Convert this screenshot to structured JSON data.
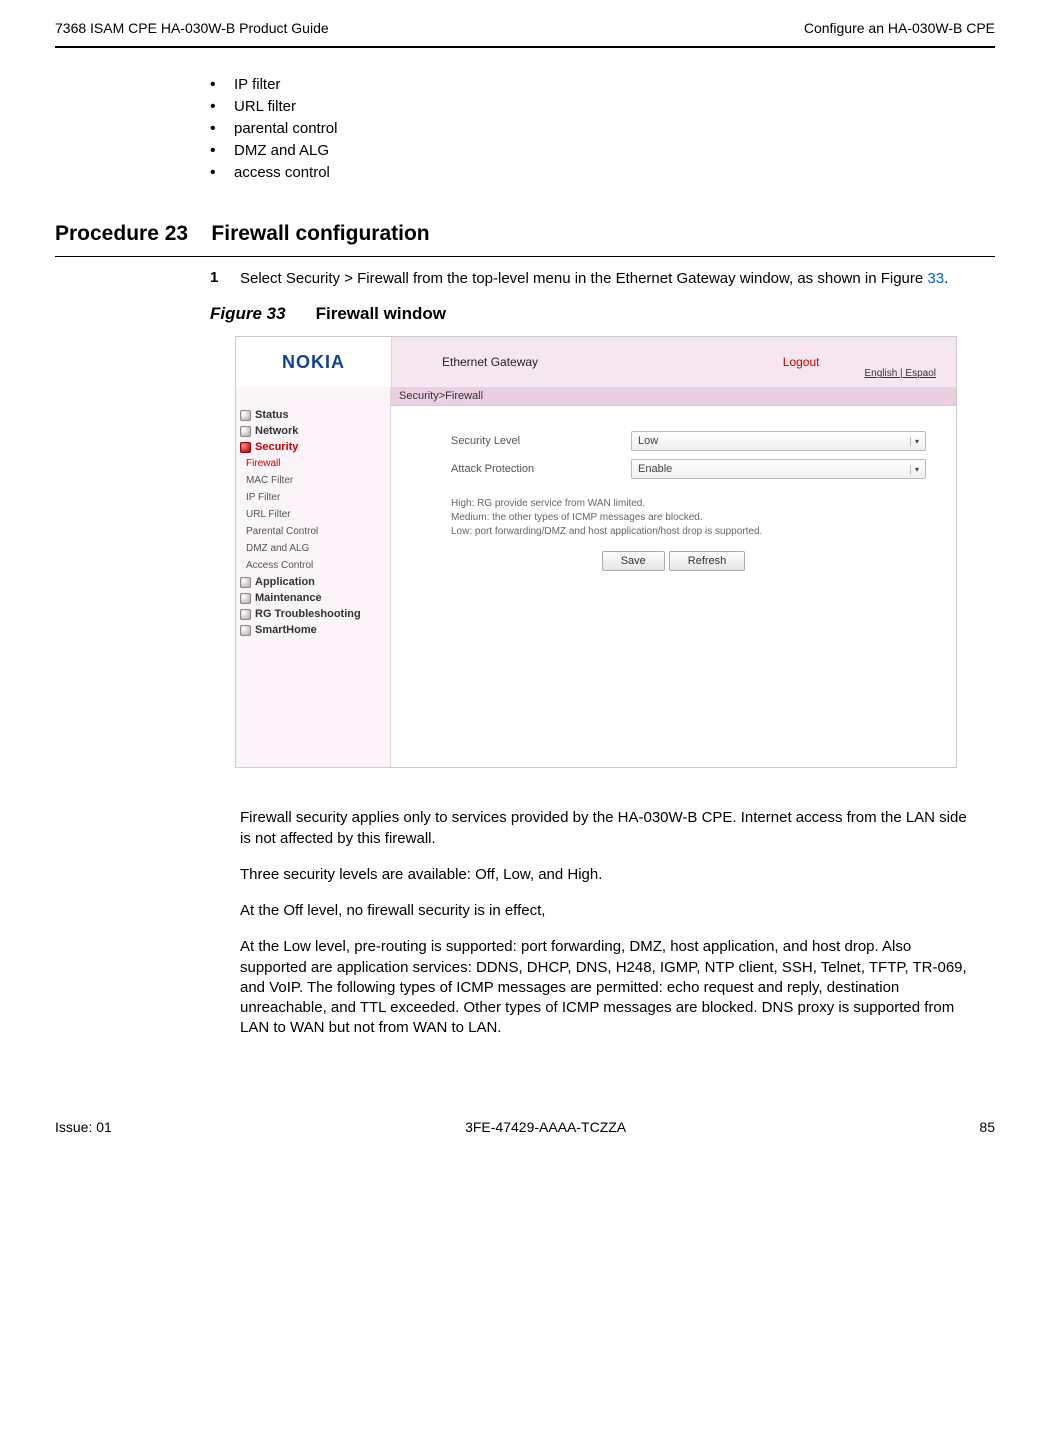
{
  "header": {
    "left": "7368 ISAM CPE HA-030W-B Product Guide",
    "right": "Configure an HA-030W-B CPE"
  },
  "bullets": [
    "IP filter",
    "URL filter",
    "parental control",
    "DMZ and ALG",
    "access control"
  ],
  "procedure": {
    "label": "Procedure 23",
    "title": "Firewall configuration"
  },
  "step1": {
    "num": "1",
    "text_before": "Select Security > Firewall from the top-level menu in the Ethernet Gateway window, as shown in Figure ",
    "link": "33",
    "text_after": "."
  },
  "figure": {
    "label": "Figure 33",
    "title": "Firewall window"
  },
  "screenshot": {
    "logo": "NOKIA",
    "title": "Ethernet Gateway",
    "logout": "Logout",
    "lang": "English | Espaol",
    "breadcrumb": "Security>Firewall",
    "sidebar": {
      "main": [
        "Status",
        "Network",
        "Security"
      ],
      "subs": [
        "Firewall",
        "MAC Filter",
        "IP Filter",
        "URL Filter",
        "Parental Control",
        "DMZ and ALG",
        "Access Control"
      ],
      "main2": [
        "Application",
        "Maintenance",
        "RG Troubleshooting",
        "SmartHome"
      ]
    },
    "form": {
      "row1": {
        "label": "Security Level",
        "value": "Low"
      },
      "row2": {
        "label": "Attack Protection",
        "value": "Enable"
      }
    },
    "help": {
      "l1": "High: RG provide service from WAN limited.",
      "l2": "Medium: the other types of ICMP messages are blocked.",
      "l3": "Low: port forwarding/DMZ and host application/host drop is supported."
    },
    "buttons": {
      "save": "Save",
      "refresh": "Refresh"
    }
  },
  "paras": [
    "Firewall security applies only to services provided by the HA-030W-B CPE. Internet access from the LAN side is not affected by this firewall.",
    "Three security levels are available: Off, Low, and High.",
    "At the Off level, no firewall security is in effect,",
    "At the Low level, pre-routing is supported: port forwarding, DMZ, host application, and host drop. Also supported are application services: DDNS, DHCP, DNS, H248, IGMP, NTP client, SSH, Telnet, TFTP, TR-069, and VoIP. The following types of ICMP messages are permitted: echo request and reply, destination unreachable, and TTL exceeded. Other types of ICMP messages are blocked. DNS proxy is supported from LAN to WAN but not from WAN to LAN."
  ],
  "footer": {
    "left": "Issue: 01",
    "center": "3FE-47429-AAAA-TCZZA",
    "right": "85"
  }
}
